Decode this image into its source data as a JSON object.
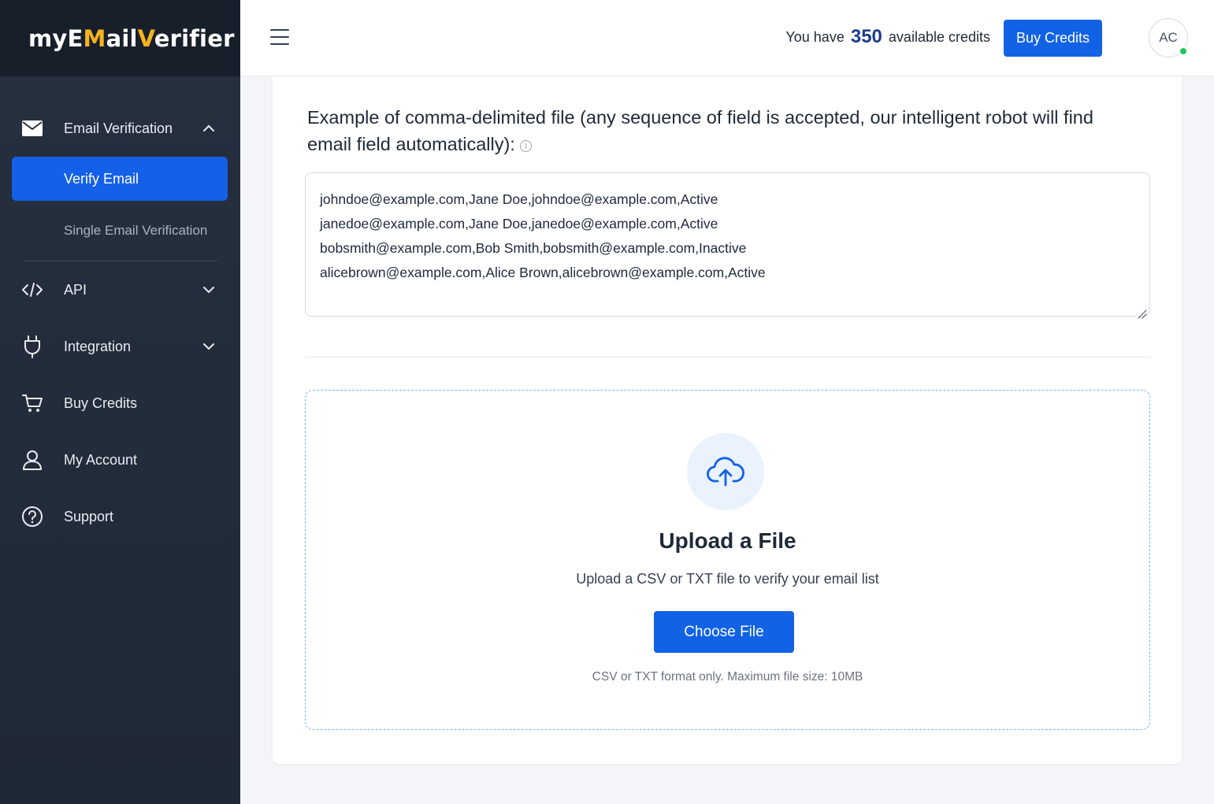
{
  "brand": {
    "logo_part1": "myE",
    "logo_accent1": "M",
    "logo_part2": "ail",
    "logo_accent2": "V",
    "logo_part3": "erifier"
  },
  "sidebar": {
    "email_verification": "Email Verification",
    "verify_email": "Verify Email",
    "single_email_verification": "Single Email Verification",
    "api": "API",
    "integration": "Integration",
    "buy_credits": "Buy Credits",
    "my_account": "My Account",
    "support": "Support"
  },
  "header": {
    "credits_prefix": "You have",
    "credits_count": "350",
    "credits_suffix": "available credits",
    "buy_button": "Buy Credits",
    "avatar_initials": "AC"
  },
  "example": {
    "title": "Example of comma-delimited file (any sequence of field is accepted, our intelligent robot will find email field automatically):",
    "info_glyph": "i",
    "lines": [
      "johndoe@example.com,Jane Doe,johndoe@example.com,Active",
      "janedoe@example.com,Jane Doe,janedoe@example.com,Active",
      "bobsmith@example.com,Bob Smith,bobsmith@example.com,Inactive",
      "alicebrown@example.com,Alice Brown,alicebrown@example.com,Active"
    ]
  },
  "upload": {
    "title": "Upload a File",
    "subtitle": "Upload a CSV or TXT file to verify your email list",
    "button": "Choose File",
    "note": "CSV or TXT format only. Maximum file size: 10MB"
  },
  "colors": {
    "primary": "#1262e6",
    "sidebar_bg": "#26303f",
    "logo_accent": "#f5b21f",
    "online_status": "#22c55e"
  },
  "icons": {
    "email_verification": "envelope-icon",
    "api": "code-icon",
    "integration": "plug-icon",
    "buy_credits": "cart-icon",
    "my_account": "user-icon",
    "support": "help-circle-icon",
    "upload": "cloud-upload-icon"
  }
}
